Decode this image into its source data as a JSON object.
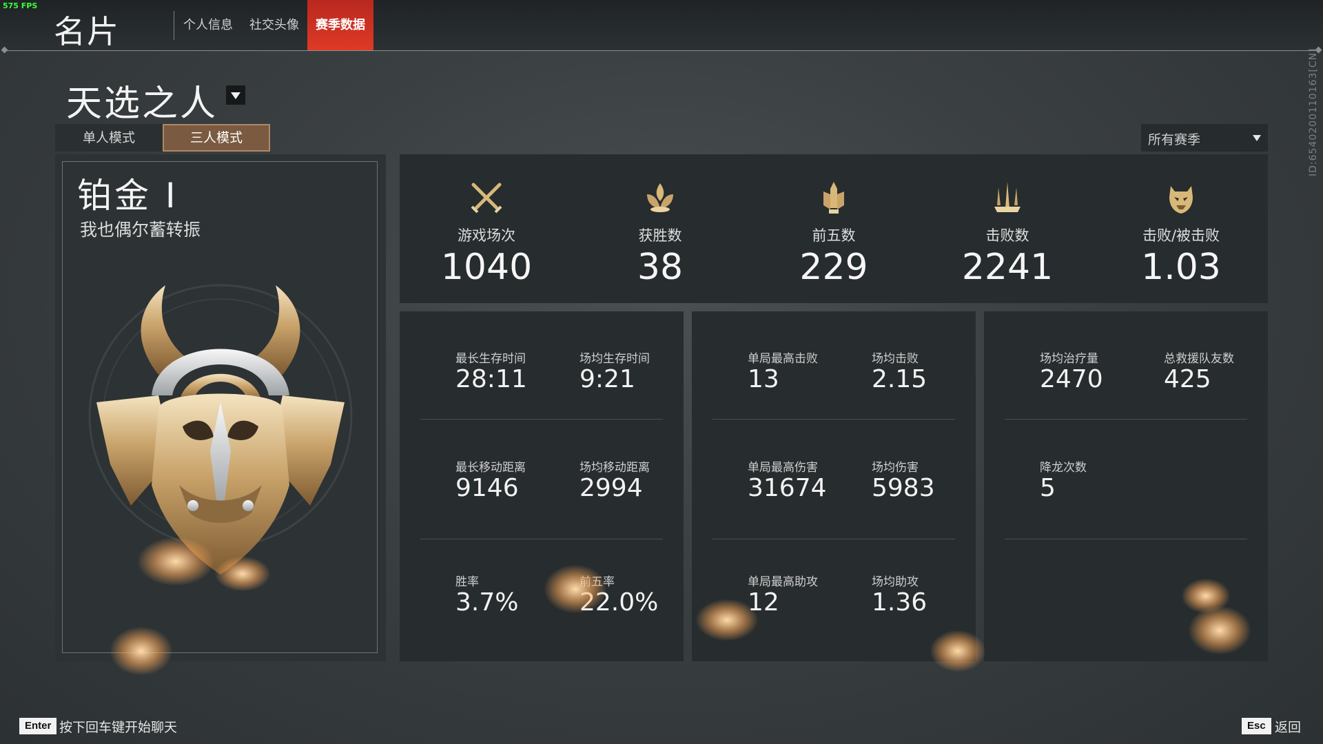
{
  "fps": "575 FPS",
  "header": {
    "title": "名片",
    "tabs": [
      {
        "label": "个人信息",
        "active": false
      },
      {
        "label": "社交头像",
        "active": false
      },
      {
        "label": "赛季数据",
        "active": true
      }
    ]
  },
  "season": {
    "title": "天选之人",
    "modes": [
      {
        "label": "单人模式",
        "active": false
      },
      {
        "label": "三人模式",
        "active": true
      }
    ],
    "season_filter": "所有赛季"
  },
  "player_id": "ID:6540200110163[CN]",
  "rank": {
    "name": "铂金 I",
    "subtitle": "我也偶尔蓄转振",
    "emblem_icon": "platinum-mask-icon"
  },
  "summary": [
    {
      "icon": "crossed-swords-icon",
      "label": "游戏场次",
      "value": "1040"
    },
    {
      "icon": "lotus-flame-icon",
      "label": "获胜数",
      "value": "38"
    },
    {
      "icon": "sword-pillar-icon",
      "label": "前五数",
      "value": "229"
    },
    {
      "icon": "trident-icon",
      "label": "击败数",
      "value": "2241"
    },
    {
      "icon": "demon-mask-icon",
      "label": "击败/被击败",
      "value": "1.03"
    }
  ],
  "panels": [
    {
      "rows": [
        [
          {
            "label": "最长生存时间",
            "value": "28:11"
          },
          {
            "label": "场均生存时间",
            "value": "9:21"
          }
        ],
        [
          {
            "label": "最长移动距离",
            "value": "9146"
          },
          {
            "label": "场均移动距离",
            "value": "2994"
          }
        ],
        [
          {
            "label": "胜率",
            "value": "3.7%"
          },
          {
            "label": "前五率",
            "value": "22.0%"
          }
        ]
      ]
    },
    {
      "rows": [
        [
          {
            "label": "单局最高击败",
            "value": "13"
          },
          {
            "label": "场均击败",
            "value": "2.15"
          }
        ],
        [
          {
            "label": "单局最高伤害",
            "value": "31674"
          },
          {
            "label": "场均伤害",
            "value": "5983"
          }
        ],
        [
          {
            "label": "单局最高助攻",
            "value": "12"
          },
          {
            "label": "场均助攻",
            "value": "1.36"
          }
        ]
      ]
    },
    {
      "rows": [
        [
          {
            "label": "场均治疗量",
            "value": "2470"
          },
          {
            "label": "总救援队友数",
            "value": "425"
          }
        ],
        [
          {
            "label": "降龙次数",
            "value": "5"
          }
        ]
      ]
    }
  ],
  "footer": {
    "chat_key": "Enter",
    "chat_hint": "按下回车键开始聊天",
    "back_key": "Esc",
    "back_label": "返回"
  },
  "colors": {
    "accent_red": "#e03a26",
    "mode_active": "#7a5a40",
    "gold": "#d8b878"
  }
}
